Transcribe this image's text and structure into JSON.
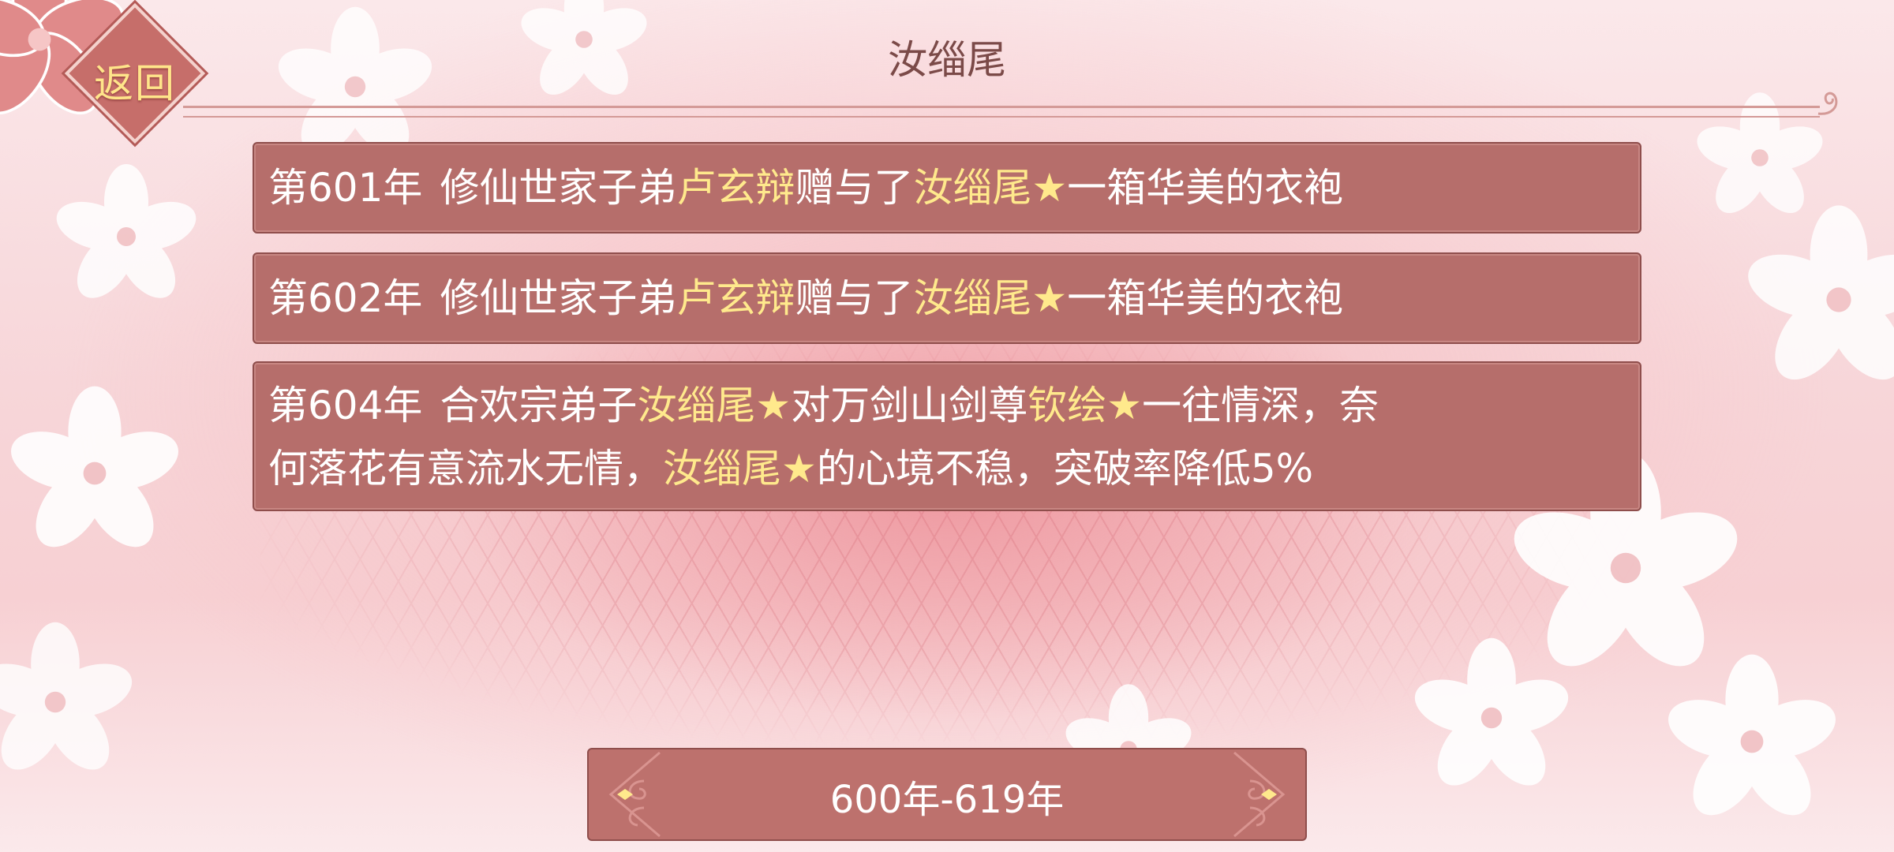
{
  "header": {
    "back_label": "返回",
    "title": "汝缁尾"
  },
  "records": [
    {
      "year": "第601年",
      "segments": [
        {
          "t": "修仙世家子弟",
          "hl": false
        },
        {
          "t": "卢玄辩",
          "hl": true
        },
        {
          "t": "赠与了",
          "hl": false
        },
        {
          "t": "汝缁尾★",
          "hl": true
        },
        {
          "t": "一箱华美的衣袍",
          "hl": false
        }
      ]
    },
    {
      "year": "第602年",
      "segments": [
        {
          "t": "修仙世家子弟",
          "hl": false
        },
        {
          "t": "卢玄辩",
          "hl": true
        },
        {
          "t": "赠与了",
          "hl": false
        },
        {
          "t": "汝缁尾★",
          "hl": true
        },
        {
          "t": "一箱华美的衣袍",
          "hl": false
        }
      ]
    },
    {
      "year": "第604年",
      "lines": [
        [
          {
            "t": "合欢宗弟子",
            "hl": false
          },
          {
            "t": "汝缁尾★",
            "hl": true
          },
          {
            "t": "对万剑山剑尊",
            "hl": false
          },
          {
            "t": "钦绘★",
            "hl": true
          },
          {
            "t": "一往情深，奈",
            "hl": false
          }
        ],
        [
          {
            "t": "何落花有意流水无情，",
            "hl": false
          },
          {
            "t": "汝缁尾★",
            "hl": true
          },
          {
            "t": "的心境不稳，突破率降低5%",
            "hl": false
          }
        ]
      ]
    }
  ],
  "period": {
    "label": "600年-619年"
  },
  "colors": {
    "panel": "#b66e6b",
    "highlight": "#ffe98c",
    "back_text": "#ffe58a",
    "title_text": "#7b4a48"
  },
  "icons": [
    "flower-icon",
    "scroll-ornament-icon",
    "cloud-ornament-icon"
  ]
}
